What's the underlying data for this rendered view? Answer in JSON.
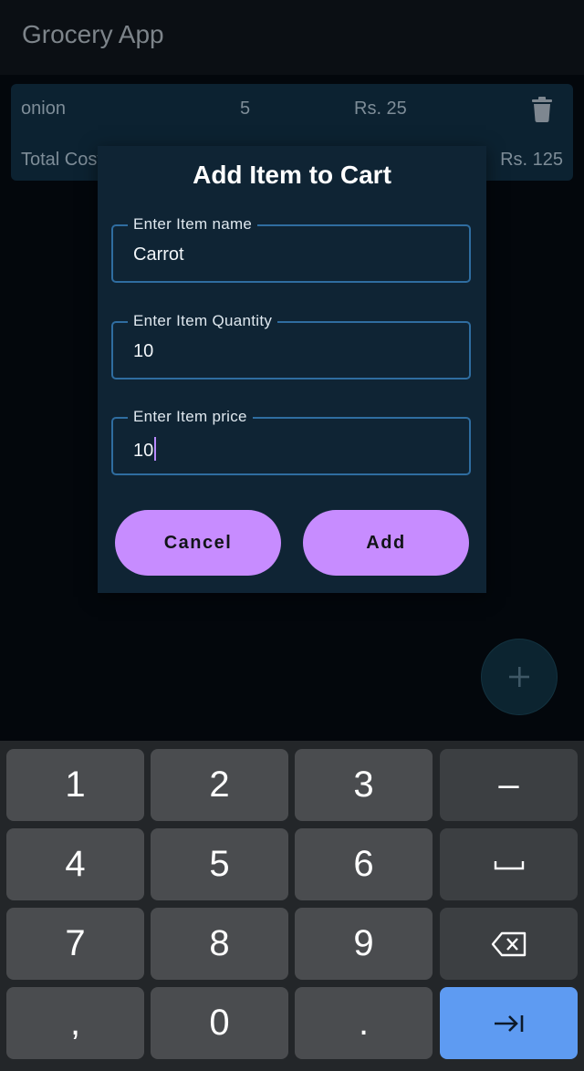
{
  "app": {
    "title": "Grocery App"
  },
  "cart": {
    "items": [
      {
        "name": "onion",
        "quantity": "5",
        "price": "Rs. 25"
      }
    ],
    "total_label": "Total Cost",
    "total_value": "Rs. 125"
  },
  "fab": {
    "icon": "plus-icon",
    "symbol": "+"
  },
  "dialog": {
    "title": "Add Item to Cart",
    "fields": [
      {
        "label": "Enter Item name",
        "value": "Carrot"
      },
      {
        "label": "Enter Item Quantity",
        "value": "10"
      },
      {
        "label": "Enter Item price",
        "value": "10"
      }
    ],
    "cancel_label": "Cancel",
    "add_label": "Add"
  },
  "keyboard": {
    "rows": [
      [
        "1",
        "2",
        "3",
        "–"
      ],
      [
        "4",
        "5",
        "6",
        "space-icon"
      ],
      [
        "7",
        "8",
        "9",
        "backspace-icon"
      ],
      [
        ",",
        "0",
        ".",
        "next-icon"
      ]
    ]
  },
  "colors": {
    "accent_button": "#c78cff",
    "field_border": "#2f6da0",
    "enter_key": "#5e9bf2",
    "caret": "#b889ff"
  }
}
